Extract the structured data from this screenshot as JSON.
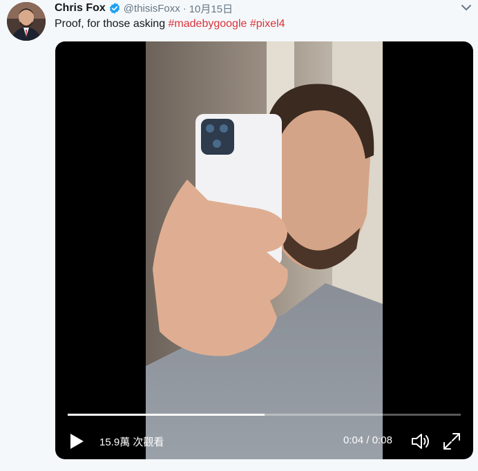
{
  "tweet": {
    "display_name": "Chris Fox",
    "handle": "@thisisFoxx",
    "separator": "·",
    "date": "10月15日",
    "text_plain": "Proof, for those asking ",
    "hashtags": [
      "#madebygoogle",
      "#pixel4"
    ]
  },
  "video": {
    "views": "15.9萬 次觀看",
    "current_time": "0:04",
    "duration": "0:08",
    "time_separator": " / ",
    "progress_fraction": 0.5
  },
  "icons": {
    "verified": "verified-badge-icon",
    "menu": "chevron-down-icon",
    "play": "play-icon",
    "volume": "volume-icon",
    "fullscreen": "fullscreen-icon"
  },
  "colors": {
    "hashtag": "#d9333b",
    "verified": "#1da1f2",
    "background": "#f5f8fa"
  }
}
